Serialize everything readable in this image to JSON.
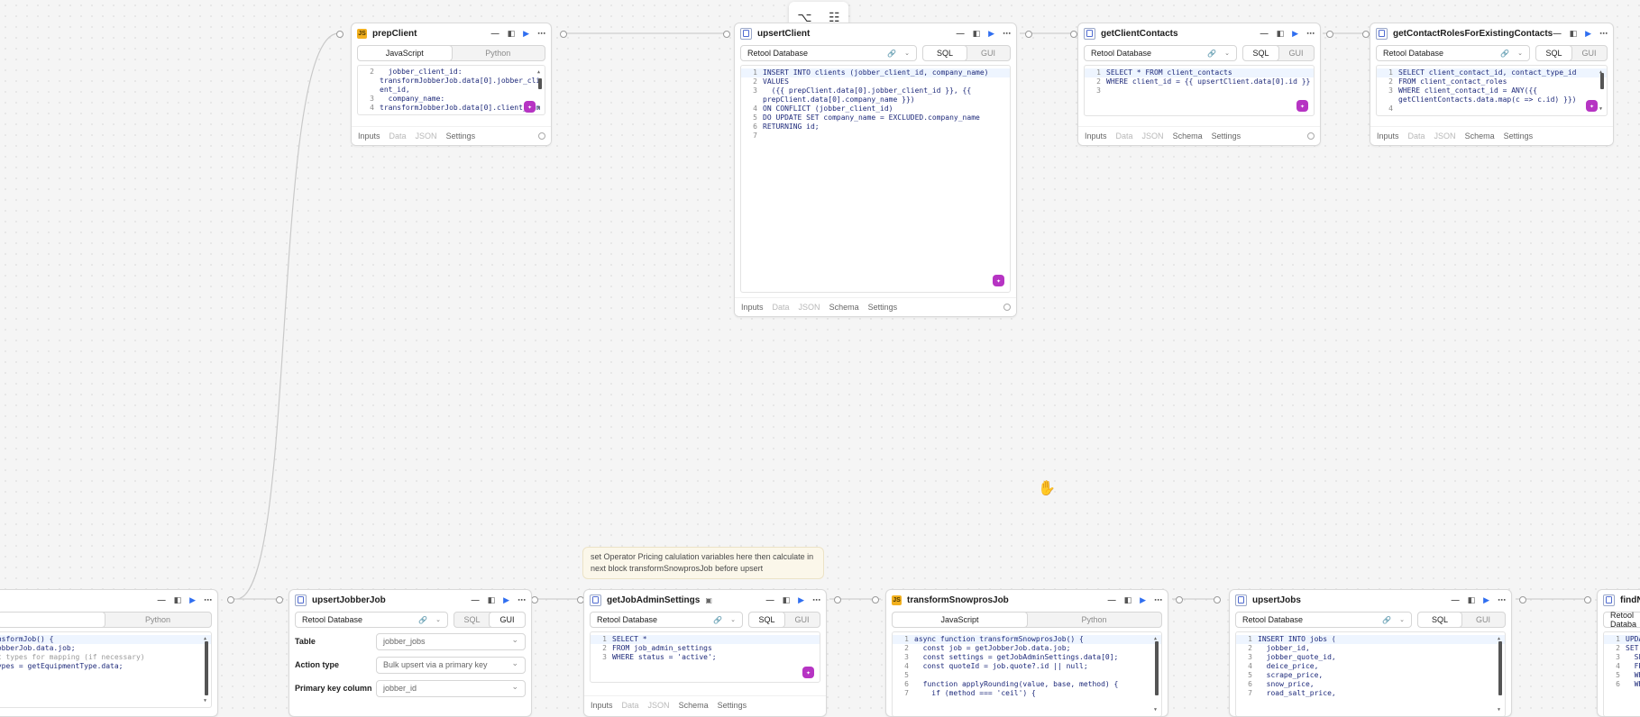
{
  "toolbar": {
    "icon_a": "diagram-icon",
    "icon_b": "tree-icon"
  },
  "tab_labels": {
    "inputs": "Inputs",
    "data": "Data",
    "json": "JSON",
    "schema": "Schema",
    "settings": "Settings"
  },
  "modes": {
    "javascript": "JavaScript",
    "python": "Python",
    "sql": "SQL",
    "gui": "GUI"
  },
  "resource": "Retool Database",
  "blocks": {
    "prepClient": {
      "name": "prepClient",
      "code": [
        {
          "n": "2",
          "t": "  jobber_client_id:"
        },
        {
          "n": "",
          "t": "transformJobberJob.data[0].jobber_cli"
        },
        {
          "n": "",
          "t": "ent_id,"
        },
        {
          "n": "3",
          "t": "  company_name:"
        },
        {
          "n": "4",
          "t": "transformJobberJob.data[0].client_com"
        }
      ]
    },
    "upsertClient": {
      "name": "upsertClient",
      "code": [
        {
          "n": "1",
          "t": "INSERT INTO clients (jobber_client_id, company_name)"
        },
        {
          "n": "2",
          "t": "VALUES"
        },
        {
          "n": "3",
          "t": "  ({{ prepClient.data[0].jobber_client_id }}, {{"
        },
        {
          "n": "",
          "t": "prepClient.data[0].company_name }})"
        },
        {
          "n": "4",
          "t": "ON CONFLICT (jobber_client_id)"
        },
        {
          "n": "5",
          "t": "DO UPDATE SET company_name = EXCLUDED.company_name"
        },
        {
          "n": "6",
          "t": "RETURNING id;"
        },
        {
          "n": "7",
          "t": ""
        }
      ]
    },
    "getClientContacts": {
      "name": "getClientContacts",
      "code": [
        {
          "n": "1",
          "t": "SELECT * FROM client_contacts"
        },
        {
          "n": "2",
          "t": "WHERE client_id = {{ upsertClient.data[0].id }}"
        },
        {
          "n": "3",
          "t": ""
        }
      ]
    },
    "getContactRoles": {
      "name": "getContactRolesForExistingContacts",
      "code": [
        {
          "n": "1",
          "t": "SELECT client_contact_id, contact_type_id"
        },
        {
          "n": "2",
          "t": "FROM client_contact_roles"
        },
        {
          "n": "3",
          "t": "WHERE client_contact_id = ANY({{"
        },
        {
          "n": "",
          "t": "getClientContacts.data.map(c => c.id) }})"
        },
        {
          "n": "4",
          "t": ""
        }
      ]
    },
    "leftJs": {
      "code": [
        {
          "n": "",
          "t": "ansformJob() {"
        },
        {
          "n": "",
          "t": "JobberJob.data.job;"
        },
        {
          "n": "",
          "t": ""
        },
        {
          "n": "",
          "t": "et types for mapping (if necessary)"
        },
        {
          "n": "",
          "t": "Types = getEquipmentType.data;"
        }
      ]
    },
    "upsertJobberJob": {
      "name": "upsertJobberJob",
      "form": [
        {
          "label": "Table",
          "value": "jobber_jobs"
        },
        {
          "label": "Action type",
          "value": "Bulk upsert via a primary key"
        },
        {
          "label": "Primary key column",
          "value": "jobber_id"
        }
      ]
    },
    "getJobAdminSettings": {
      "name": "getJobAdminSettings",
      "code": [
        {
          "n": "1",
          "t": "SELECT *"
        },
        {
          "n": "2",
          "t": "FROM job_admin_settings"
        },
        {
          "n": "3",
          "t": "WHERE status = 'active';"
        }
      ]
    },
    "transformSnowprosJob": {
      "name": "transformSnowprosJob",
      "code": [
        {
          "n": "1",
          "t": "async function transformSnowprosJob() {"
        },
        {
          "n": "2",
          "t": "  const job = getJobberJob.data.job;"
        },
        {
          "n": "3",
          "t": "  const settings = getJobAdminSettings.data[0];"
        },
        {
          "n": "4",
          "t": "  const quoteId = job.quote?.id || null;"
        },
        {
          "n": "5",
          "t": ""
        },
        {
          "n": "6",
          "t": "  function applyRounding(value, base, method) {"
        },
        {
          "n": "7",
          "t": "    if (method === 'ceil') {"
        }
      ]
    },
    "upsertJobs": {
      "name": "upsertJobs",
      "code": [
        {
          "n": "1",
          "t": "INSERT INTO jobs ("
        },
        {
          "n": "2",
          "t": "  jobber_id,"
        },
        {
          "n": "3",
          "t": "  jobber_quote_id,"
        },
        {
          "n": "4",
          "t": "  deice_price,"
        },
        {
          "n": "5",
          "t": "  scrape_price,"
        },
        {
          "n": "6",
          "t": "  snow_price,"
        },
        {
          "n": "7",
          "t": "  road_salt_price,"
        }
      ]
    },
    "findNear": {
      "name": "findNea",
      "resource": "Retool Databa",
      "code": [
        {
          "n": "1",
          "t": "UPDAT"
        },
        {
          "n": "2",
          "t": "SET r"
        },
        {
          "n": "3",
          "t": "  SEL"
        },
        {
          "n": "4",
          "t": "  FRO"
        },
        {
          "n": "5",
          "t": "  WHE"
        },
        {
          "n": "6",
          "t": "  WHE"
        }
      ]
    }
  },
  "note": "set Operator Pricing calulation variables here then calculate in next block transformSnowprosJob before upsert",
  "colors": {
    "accent": "#2f6ef0",
    "ai": "#b634c3",
    "js": "#f2b01e"
  }
}
